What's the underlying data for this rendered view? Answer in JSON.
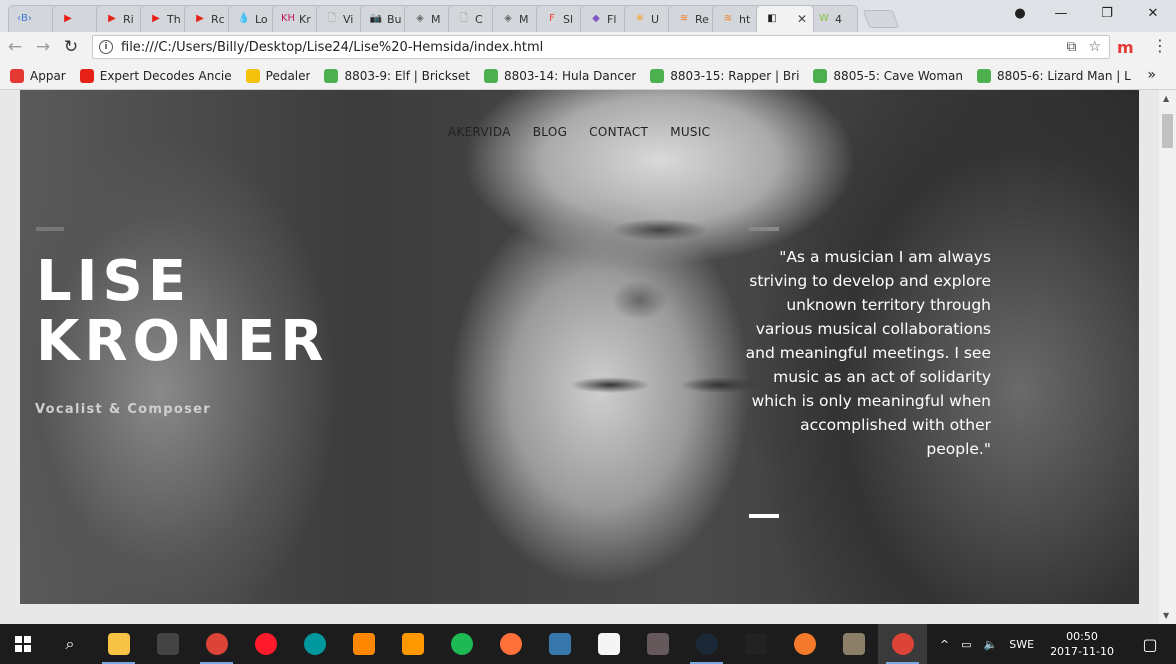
{
  "browser": {
    "tabs": [
      {
        "label": "",
        "color": "#3b7bd4",
        "glyph": "‹B›"
      },
      {
        "label": "",
        "color": "#e62117",
        "glyph": "▶"
      },
      {
        "label": "Ri",
        "color": "#e62117",
        "glyph": "▶"
      },
      {
        "label": "Th",
        "color": "#e62117",
        "glyph": "▶"
      },
      {
        "label": "Rc",
        "color": "#e62117",
        "glyph": "▶"
      },
      {
        "label": "Lo",
        "color": "#3a78c2",
        "glyph": "💧"
      },
      {
        "label": "Kr",
        "color": "#c2185b",
        "glyph": "KH"
      },
      {
        "label": "Vi",
        "color": "#9e9e9e",
        "glyph": "🗋"
      },
      {
        "label": "Bu",
        "color": "#333333",
        "glyph": "📷"
      },
      {
        "label": "M",
        "color": "#666666",
        "glyph": "◈"
      },
      {
        "label": "C",
        "color": "#9e9e9e",
        "glyph": "🗋"
      },
      {
        "label": "M",
        "color": "#666666",
        "glyph": "◈"
      },
      {
        "label": "Sl",
        "color": "#f44336",
        "glyph": "F"
      },
      {
        "label": "Fl",
        "color": "#7e57c2",
        "glyph": "◆"
      },
      {
        "label": "U",
        "color": "#ff9800",
        "glyph": "✳"
      },
      {
        "label": "Re",
        "color": "#f48024",
        "glyph": "≋"
      },
      {
        "label": "ht",
        "color": "#f48024",
        "glyph": "≋"
      },
      {
        "label": "",
        "color": "#222222",
        "glyph": "◧",
        "active": true
      },
      {
        "label": "4",
        "color": "#8bc34a",
        "glyph": "W"
      }
    ],
    "close_glyph": "✕",
    "window_controls": {
      "profile": "●",
      "minimize": "—",
      "maximize": "❐",
      "close": "✕"
    },
    "nav": {
      "back": "←",
      "forward": "→",
      "reload": "↻"
    },
    "address": "file:///C:/Users/Billy/Desktop/Lise24/Lise%20-Hemsida/index.html",
    "address_icons": {
      "info": "i",
      "translate": "⧉",
      "star": "☆"
    },
    "extension": "m",
    "menu": "⋮",
    "bookmarks": [
      {
        "label": "Appar",
        "color": "#e53935"
      },
      {
        "label": "Expert Decodes Ancie",
        "color": "#e62117"
      },
      {
        "label": "Pedaler",
        "color": "#f4c20d"
      },
      {
        "label": "8803-9: Elf | Brickset",
        "color": "#4caf50"
      },
      {
        "label": "8803-14: Hula Dancer",
        "color": "#4caf50"
      },
      {
        "label": "8803-15: Rapper | Bri",
        "color": "#4caf50"
      },
      {
        "label": "8805-5: Cave Woman",
        "color": "#4caf50"
      },
      {
        "label": "8805-6: Lizard Man | L",
        "color": "#4caf50"
      }
    ],
    "bookmarks_more": "»"
  },
  "site": {
    "nav": [
      "AKERVIDA",
      "BLOG",
      "CONTACT",
      "MUSIC"
    ],
    "name_line1": "LISE",
    "name_line2": "KRONER",
    "subtitle": "Vocalist & Composer",
    "quote": "\"As a musician I am always striving to develop and explore unknown territory through various musical collaborations and meaningful meetings. I see music as an act of solidarity which is only meaningful when accomplished with other people.\""
  },
  "taskbar": {
    "apps": [
      {
        "name": "file-explorer",
        "color": "#f6c344"
      },
      {
        "name": "terminal",
        "color": "#444444"
      },
      {
        "name": "chrome",
        "color": "#db4437"
      },
      {
        "name": "opera",
        "color": "#ff1b2d"
      },
      {
        "name": "arduino",
        "color": "#00979d"
      },
      {
        "name": "vlc",
        "color": "#ff8800"
      },
      {
        "name": "sublime-text",
        "color": "#ff9800"
      },
      {
        "name": "spotify",
        "color": "#1db954"
      },
      {
        "name": "firefox",
        "color": "#ff7139"
      },
      {
        "name": "python",
        "color": "#3776ab"
      },
      {
        "name": "notepad",
        "color": "#f5f5f5"
      },
      {
        "name": "atom",
        "color": "#66595c"
      },
      {
        "name": "steam",
        "color": "#1b2838"
      },
      {
        "name": "paint-net",
        "color": "#222222"
      },
      {
        "name": "blender",
        "color": "#f5792a"
      },
      {
        "name": "gimp",
        "color": "#8c7f6a"
      },
      {
        "name": "chrome-active",
        "color": "#db4437"
      }
    ],
    "search": "⌕",
    "tray": {
      "chevron": "^",
      "network": "▭",
      "volume": "🔈",
      "lang": "SWE"
    },
    "time": "00:50",
    "date": "2017-11-10",
    "notification": "▢"
  }
}
